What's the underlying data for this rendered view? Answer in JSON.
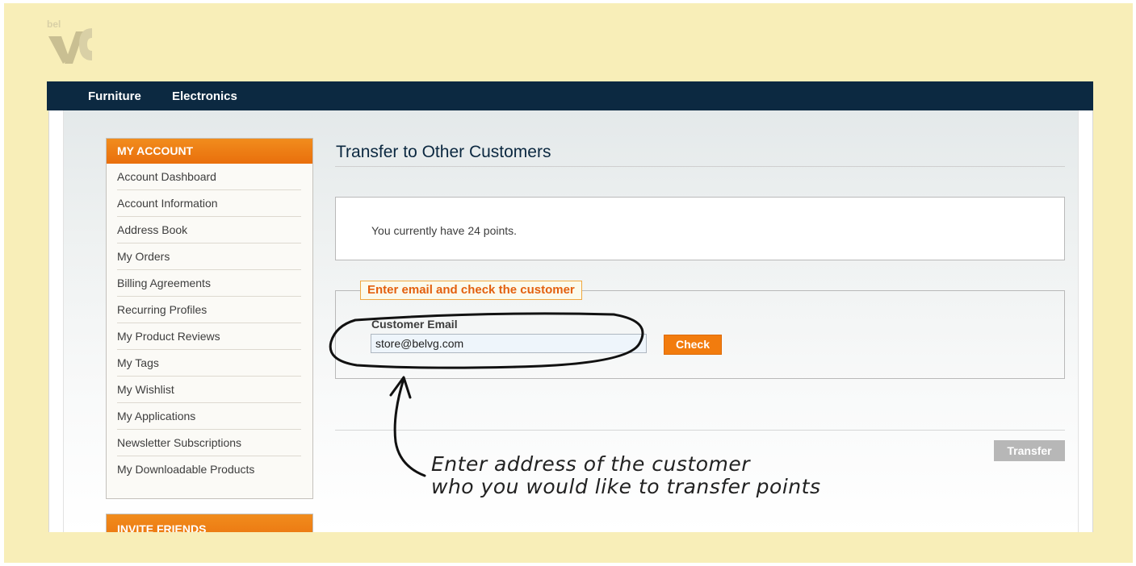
{
  "nav": {
    "items": [
      "Furniture",
      "Electronics"
    ]
  },
  "sidebar": {
    "title": "MY ACCOUNT",
    "items": [
      "Account Dashboard",
      "Account Information",
      "Address Book",
      "My Orders",
      "Billing Agreements",
      "Recurring Profiles",
      "My Product Reviews",
      "My Tags",
      "My Wishlist",
      "My Applications",
      "Newsletter Subscriptions",
      "My Downloadable Products"
    ],
    "invite_title": "INVITE FRIENDS"
  },
  "main": {
    "title": "Transfer to Other Customers",
    "points_text": "You currently have 24 points.",
    "legend": "Enter email and check the customer",
    "email_label": "Customer Email",
    "email_value": "store@belvg.com",
    "check_label": "Check",
    "transfer_label": "Transfer"
  },
  "annotation": {
    "line1": "Enter address of the customer",
    "line2": "who you would like to transfer points"
  },
  "colors": {
    "background": "#f8eeb8",
    "nav": "#0c2941",
    "accent": "#f27c0e",
    "legend_text": "#e3600f"
  },
  "icons": {
    "logo": "belvg-logo"
  }
}
